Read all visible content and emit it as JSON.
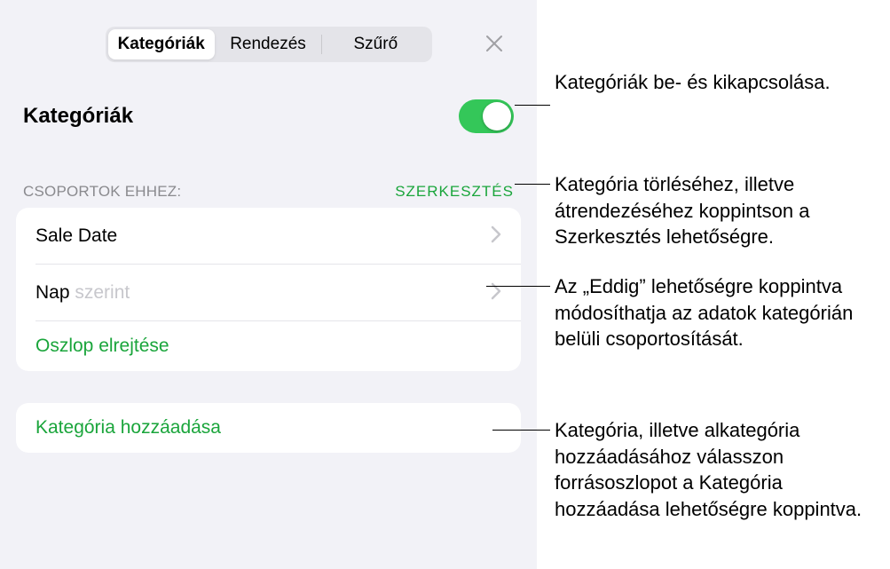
{
  "tabs": {
    "categories": "Kategóriák",
    "sort": "Rendezés",
    "filter": "Szűrő"
  },
  "panel": {
    "title": "Kategóriák",
    "groups_for": "CSOPORTOK EHHEZ:",
    "edit": "SZERKESZTÉS",
    "row_sale_date": "Sale Date",
    "row_by_day_prime": "Nap",
    "row_by_day_suffix": " szerint",
    "row_hide_column": "Oszlop elrejtése",
    "row_add_category": "Kategória hozzáadása"
  },
  "callouts": {
    "toggle": "Kategóriák be- és kikapcsolása.",
    "edit": "Kategória törléséhez, illetve átrendezéséhez koppintson a Szerkesztés lehetőségre.",
    "byday": "Az „Eddig” lehetőségre koppintva módosíthatja az adatok kategórián belüli csoportosítását.",
    "add": "Kategória, illetve alkategória hozzáadásához válasszon forrásoszlopot a Kategória hozzáadása lehetőségre koppintva."
  }
}
